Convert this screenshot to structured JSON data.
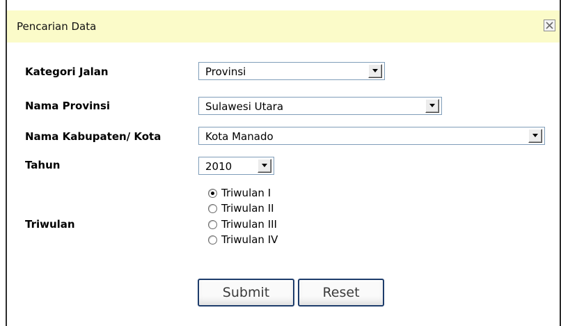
{
  "dialog": {
    "title": "Pencarian Data",
    "close_icon": "close-icon"
  },
  "form": {
    "kategori_label": "Kategori Jalan",
    "kategori_value": "Provinsi",
    "provinsi_label": "Nama Provinsi",
    "provinsi_value": "Sulawesi Utara",
    "kabupaten_label": "Nama Kabupaten/ Kota",
    "kabupaten_value": "Kota Manado",
    "tahun_label": "Tahun",
    "tahun_value": "2010",
    "triwulan_label": "Triwulan",
    "triwulan_options": [
      {
        "label": "Triwulan I",
        "selected": true
      },
      {
        "label": "Triwulan II",
        "selected": false
      },
      {
        "label": "Triwulan III",
        "selected": false
      },
      {
        "label": "Triwulan IV",
        "selected": false
      }
    ],
    "submit_label": "Submit",
    "reset_label": "Reset"
  },
  "colors": {
    "titlebar_bg": "#fbfbc9",
    "select_border": "#7f9db9",
    "button_border": "#1d3c6b"
  },
  "icons": {
    "dropdown": "chevron-down-icon",
    "close": "close-icon"
  }
}
